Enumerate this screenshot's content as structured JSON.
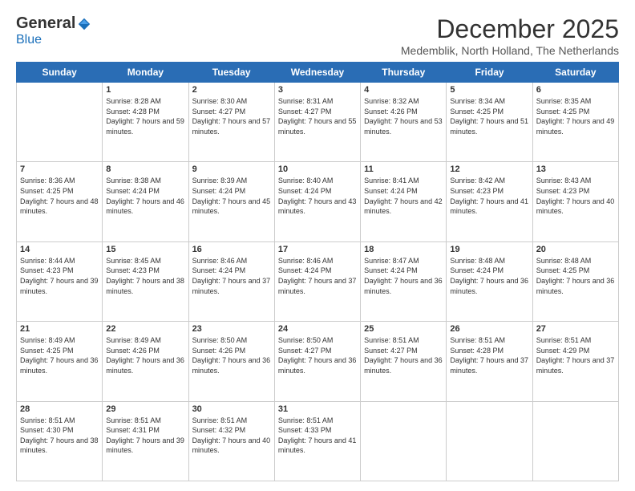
{
  "logo": {
    "general": "General",
    "blue": "Blue"
  },
  "header": {
    "month": "December 2025",
    "location": "Medemblik, North Holland, The Netherlands"
  },
  "weekdays": [
    "Sunday",
    "Monday",
    "Tuesday",
    "Wednesday",
    "Thursday",
    "Friday",
    "Saturday"
  ],
  "weeks": [
    [
      {
        "day": "",
        "sunrise": "",
        "sunset": "",
        "daylight": ""
      },
      {
        "day": "1",
        "sunrise": "Sunrise: 8:28 AM",
        "sunset": "Sunset: 4:28 PM",
        "daylight": "Daylight: 7 hours and 59 minutes."
      },
      {
        "day": "2",
        "sunrise": "Sunrise: 8:30 AM",
        "sunset": "Sunset: 4:27 PM",
        "daylight": "Daylight: 7 hours and 57 minutes."
      },
      {
        "day": "3",
        "sunrise": "Sunrise: 8:31 AM",
        "sunset": "Sunset: 4:27 PM",
        "daylight": "Daylight: 7 hours and 55 minutes."
      },
      {
        "day": "4",
        "sunrise": "Sunrise: 8:32 AM",
        "sunset": "Sunset: 4:26 PM",
        "daylight": "Daylight: 7 hours and 53 minutes."
      },
      {
        "day": "5",
        "sunrise": "Sunrise: 8:34 AM",
        "sunset": "Sunset: 4:25 PM",
        "daylight": "Daylight: 7 hours and 51 minutes."
      },
      {
        "day": "6",
        "sunrise": "Sunrise: 8:35 AM",
        "sunset": "Sunset: 4:25 PM",
        "daylight": "Daylight: 7 hours and 49 minutes."
      }
    ],
    [
      {
        "day": "7",
        "sunrise": "Sunrise: 8:36 AM",
        "sunset": "Sunset: 4:25 PM",
        "daylight": "Daylight: 7 hours and 48 minutes."
      },
      {
        "day": "8",
        "sunrise": "Sunrise: 8:38 AM",
        "sunset": "Sunset: 4:24 PM",
        "daylight": "Daylight: 7 hours and 46 minutes."
      },
      {
        "day": "9",
        "sunrise": "Sunrise: 8:39 AM",
        "sunset": "Sunset: 4:24 PM",
        "daylight": "Daylight: 7 hours and 45 minutes."
      },
      {
        "day": "10",
        "sunrise": "Sunrise: 8:40 AM",
        "sunset": "Sunset: 4:24 PM",
        "daylight": "Daylight: 7 hours and 43 minutes."
      },
      {
        "day": "11",
        "sunrise": "Sunrise: 8:41 AM",
        "sunset": "Sunset: 4:24 PM",
        "daylight": "Daylight: 7 hours and 42 minutes."
      },
      {
        "day": "12",
        "sunrise": "Sunrise: 8:42 AM",
        "sunset": "Sunset: 4:23 PM",
        "daylight": "Daylight: 7 hours and 41 minutes."
      },
      {
        "day": "13",
        "sunrise": "Sunrise: 8:43 AM",
        "sunset": "Sunset: 4:23 PM",
        "daylight": "Daylight: 7 hours and 40 minutes."
      }
    ],
    [
      {
        "day": "14",
        "sunrise": "Sunrise: 8:44 AM",
        "sunset": "Sunset: 4:23 PM",
        "daylight": "Daylight: 7 hours and 39 minutes."
      },
      {
        "day": "15",
        "sunrise": "Sunrise: 8:45 AM",
        "sunset": "Sunset: 4:23 PM",
        "daylight": "Daylight: 7 hours and 38 minutes."
      },
      {
        "day": "16",
        "sunrise": "Sunrise: 8:46 AM",
        "sunset": "Sunset: 4:24 PM",
        "daylight": "Daylight: 7 hours and 37 minutes."
      },
      {
        "day": "17",
        "sunrise": "Sunrise: 8:46 AM",
        "sunset": "Sunset: 4:24 PM",
        "daylight": "Daylight: 7 hours and 37 minutes."
      },
      {
        "day": "18",
        "sunrise": "Sunrise: 8:47 AM",
        "sunset": "Sunset: 4:24 PM",
        "daylight": "Daylight: 7 hours and 36 minutes."
      },
      {
        "day": "19",
        "sunrise": "Sunrise: 8:48 AM",
        "sunset": "Sunset: 4:24 PM",
        "daylight": "Daylight: 7 hours and 36 minutes."
      },
      {
        "day": "20",
        "sunrise": "Sunrise: 8:48 AM",
        "sunset": "Sunset: 4:25 PM",
        "daylight": "Daylight: 7 hours and 36 minutes."
      }
    ],
    [
      {
        "day": "21",
        "sunrise": "Sunrise: 8:49 AM",
        "sunset": "Sunset: 4:25 PM",
        "daylight": "Daylight: 7 hours and 36 minutes."
      },
      {
        "day": "22",
        "sunrise": "Sunrise: 8:49 AM",
        "sunset": "Sunset: 4:26 PM",
        "daylight": "Daylight: 7 hours and 36 minutes."
      },
      {
        "day": "23",
        "sunrise": "Sunrise: 8:50 AM",
        "sunset": "Sunset: 4:26 PM",
        "daylight": "Daylight: 7 hours and 36 minutes."
      },
      {
        "day": "24",
        "sunrise": "Sunrise: 8:50 AM",
        "sunset": "Sunset: 4:27 PM",
        "daylight": "Daylight: 7 hours and 36 minutes."
      },
      {
        "day": "25",
        "sunrise": "Sunrise: 8:51 AM",
        "sunset": "Sunset: 4:27 PM",
        "daylight": "Daylight: 7 hours and 36 minutes."
      },
      {
        "day": "26",
        "sunrise": "Sunrise: 8:51 AM",
        "sunset": "Sunset: 4:28 PM",
        "daylight": "Daylight: 7 hours and 37 minutes."
      },
      {
        "day": "27",
        "sunrise": "Sunrise: 8:51 AM",
        "sunset": "Sunset: 4:29 PM",
        "daylight": "Daylight: 7 hours and 37 minutes."
      }
    ],
    [
      {
        "day": "28",
        "sunrise": "Sunrise: 8:51 AM",
        "sunset": "Sunset: 4:30 PM",
        "daylight": "Daylight: 7 hours and 38 minutes."
      },
      {
        "day": "29",
        "sunrise": "Sunrise: 8:51 AM",
        "sunset": "Sunset: 4:31 PM",
        "daylight": "Daylight: 7 hours and 39 minutes."
      },
      {
        "day": "30",
        "sunrise": "Sunrise: 8:51 AM",
        "sunset": "Sunset: 4:32 PM",
        "daylight": "Daylight: 7 hours and 40 minutes."
      },
      {
        "day": "31",
        "sunrise": "Sunrise: 8:51 AM",
        "sunset": "Sunset: 4:33 PM",
        "daylight": "Daylight: 7 hours and 41 minutes."
      },
      {
        "day": "",
        "sunrise": "",
        "sunset": "",
        "daylight": ""
      },
      {
        "day": "",
        "sunrise": "",
        "sunset": "",
        "daylight": ""
      },
      {
        "day": "",
        "sunrise": "",
        "sunset": "",
        "daylight": ""
      }
    ]
  ]
}
